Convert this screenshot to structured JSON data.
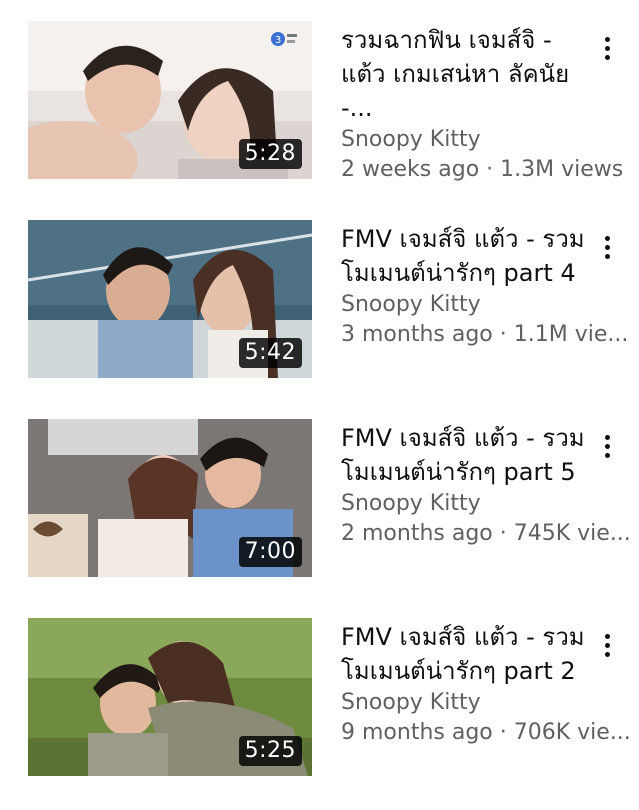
{
  "videos": [
    {
      "title": "รวมฉากฟิน เจมส์จิ - แต้ว เกมเสน่หา ลัคนัย -...",
      "channel": "Snoopy Kitty",
      "stats": "2 weeks ago · 1.3M views",
      "duration": "5:28",
      "more_icon": "more-vert-icon"
    },
    {
      "title": "FMV เจมส์จิ แต้ว - รวมโมเมนต์น่ารักๆ part 4",
      "channel": "Snoopy Kitty",
      "stats": "3 months ago · 1.1M vie...",
      "duration": "5:42",
      "more_icon": "more-vert-icon"
    },
    {
      "title": "FMV เจมส์จิ แต้ว - รวมโมเมนต์น่ารักๆ part 5",
      "channel": "Snoopy Kitty",
      "stats": "2 months ago · 745K vie...",
      "duration": "7:00",
      "more_icon": "more-vert-icon"
    },
    {
      "title": "FMV เจมส์จิ แต้ว - รวมโมเมนต์น่ารักๆ part 2",
      "channel": "Snoopy Kitty",
      "stats": "9 months ago · 706K vie...",
      "duration": "5:25",
      "more_icon": "more-vert-icon"
    }
  ],
  "colors": {
    "title_text": "#0f0f0f",
    "secondary_text": "#606060",
    "duration_bg": "#000000",
    "background": "#ffffff"
  }
}
